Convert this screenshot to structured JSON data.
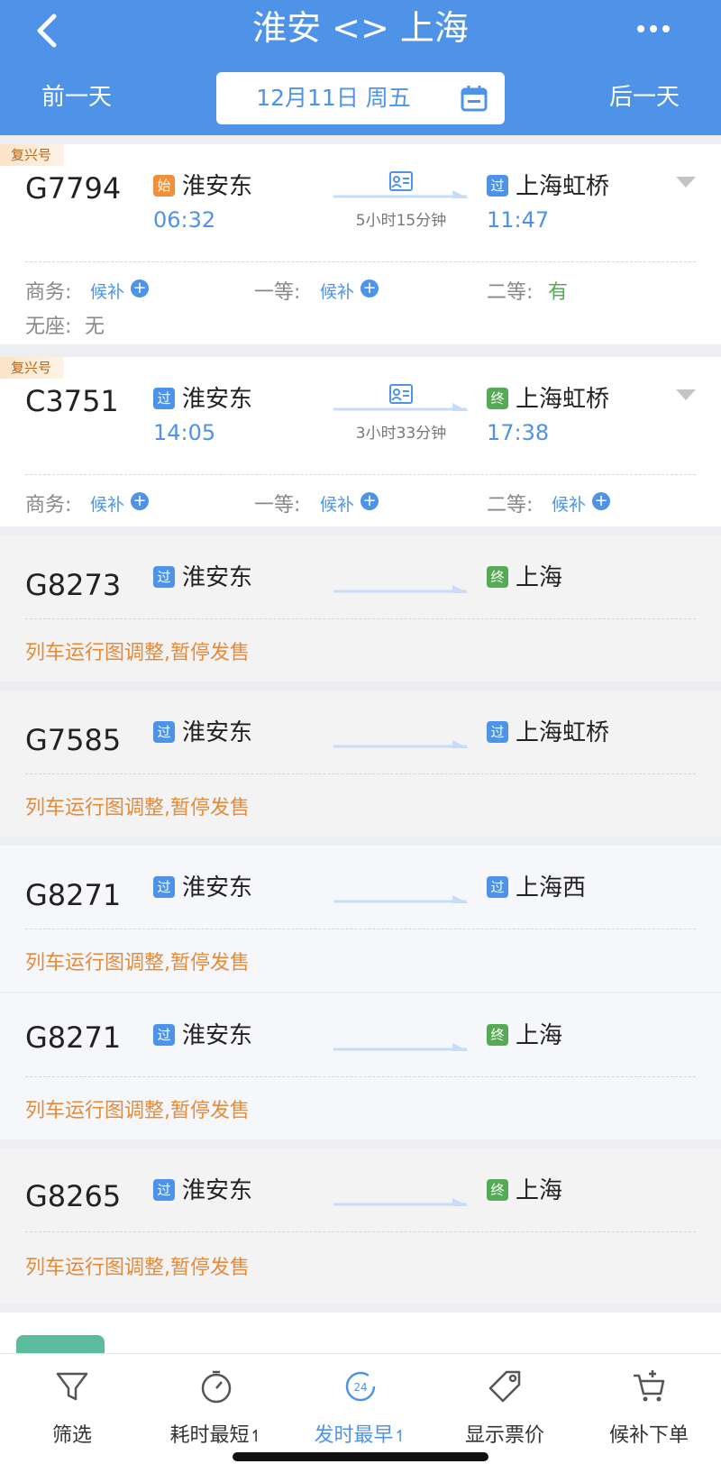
{
  "header": {
    "title": "淮安 <> 上海",
    "prev_day": "前一天",
    "next_day": "后一天",
    "date": "12月11日 周五"
  },
  "trains": [
    {
      "badge": "复兴号",
      "number": "G7794",
      "from_tag": "始",
      "from": "淮安东",
      "dep": "06:32",
      "to_tag": "过",
      "to": "上海虹桥",
      "arr": "11:47",
      "duration": "5小时15分钟",
      "seats": [
        {
          "label": "商务:",
          "value": "候补"
        },
        {
          "label": "一等:",
          "value": "候补"
        },
        {
          "label": "二等:",
          "value": "有"
        },
        {
          "label": "无座:",
          "value": "无"
        }
      ]
    },
    {
      "badge": "复兴号",
      "number": "C3751",
      "from_tag": "过",
      "from": "淮安东",
      "dep": "14:05",
      "to_tag": "终",
      "to": "上海虹桥",
      "arr": "17:38",
      "duration": "3小时33分钟",
      "seats": [
        {
          "label": "商务:",
          "value": "候补"
        },
        {
          "label": "一等:",
          "value": "候补"
        },
        {
          "label": "二等:",
          "value": "候补"
        }
      ]
    },
    {
      "number": "G8273",
      "from_tag": "过",
      "from": "淮安东",
      "to_tag": "终",
      "to": "上海",
      "status": "列车运行图调整,暂停发售"
    },
    {
      "number": "G7585",
      "from_tag": "过",
      "from": "淮安东",
      "to_tag": "过",
      "to": "上海虹桥",
      "status": "列车运行图调整,暂停发售"
    },
    {
      "number": "G8271",
      "from_tag": "过",
      "from": "淮安东",
      "to_tag": "过",
      "to": "上海西",
      "status": "列车运行图调整,暂停发售"
    },
    {
      "number": "G8271",
      "from_tag": "过",
      "from": "淮安东",
      "to_tag": "终",
      "to": "上海",
      "status": "列车运行图调整,暂停发售"
    },
    {
      "number": "G8265",
      "from_tag": "过",
      "from": "淮安东",
      "to_tag": "终",
      "to": "上海",
      "status": "列车运行图调整,暂停发售"
    }
  ],
  "tabbar": {
    "filter": "筛选",
    "shortest": "耗时最短",
    "earliest": "发时最早",
    "earliest_icon_text": "24",
    "show_price": "显示票价",
    "waitlist_order": "候补下单"
  },
  "colors": {
    "accent": "#4f93e8",
    "warning": "#e48b3a",
    "available": "#55aa55"
  }
}
